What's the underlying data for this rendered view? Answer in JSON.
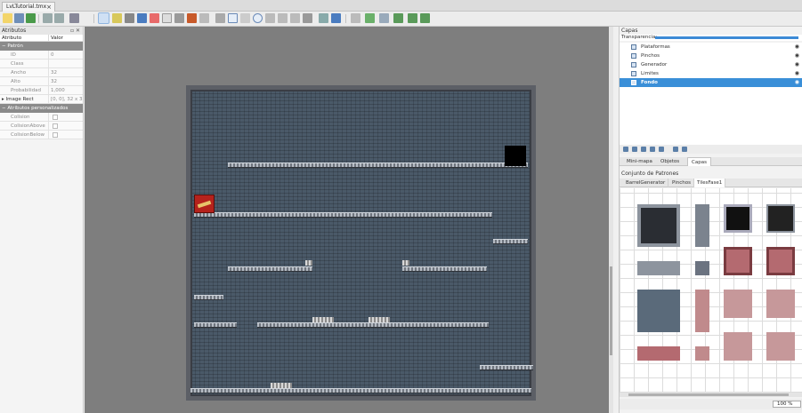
{
  "document_tab": {
    "label": "LvLTutorial.tmx",
    "close": "×"
  },
  "attributes_panel": {
    "title": "Atributos",
    "columns": [
      "Atributo",
      "Valor"
    ],
    "group_tile": "Patrón",
    "rows": [
      {
        "key": "ID",
        "value": "0"
      },
      {
        "key": "Class",
        "value": ""
      },
      {
        "key": "Ancho",
        "value": "32"
      },
      {
        "key": "Alto",
        "value": "32"
      },
      {
        "key": "Probabilidad",
        "value": "1,000"
      },
      {
        "key": "Image Rect",
        "value": "[0, 0], 32 x 32"
      }
    ],
    "group_custom": "Atributos personalizados",
    "custom_rows": [
      "Colision",
      "ColisionAbove",
      "ColisionBelow"
    ]
  },
  "layers_panel": {
    "title": "Capas",
    "opacity_label": "Transparencia:",
    "layers": [
      "Plataformas",
      "Pinchos",
      "Generador",
      "Limites",
      "Fondo"
    ],
    "active_layer": "Fondo"
  },
  "bottom_tabs": [
    "Mini-mapa",
    "Objetos",
    "Capas"
  ],
  "tileset_panel": {
    "title": "Conjunto de Patrones",
    "tabs": [
      "BarrelGenerator",
      "Pinchos",
      "TilesFase1"
    ],
    "active_tab": "TilesFase1"
  },
  "zoom": "100 %",
  "colors": {
    "accent": "#3a8fd8",
    "map_bg": "#4a5968",
    "barrel": "#b5221c"
  }
}
